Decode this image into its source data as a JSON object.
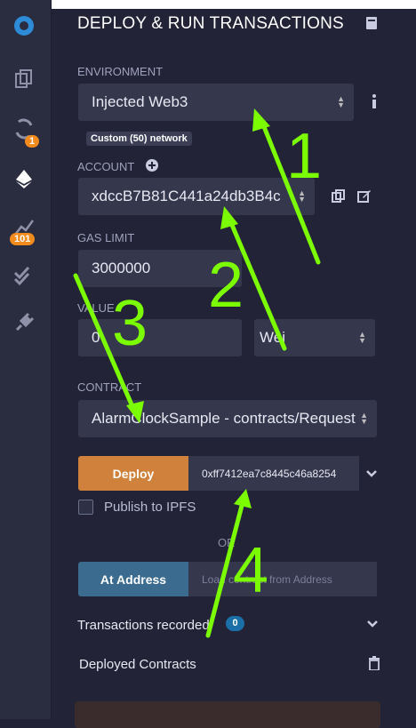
{
  "panel": {
    "title": "DEPLOY & RUN TRANSACTIONS"
  },
  "sidebar": {
    "badge_plugin": "1",
    "badge_analysis": "101"
  },
  "environment": {
    "label": "ENVIRONMENT",
    "value": "Injected Web3",
    "network": "Custom (50) network"
  },
  "account": {
    "label": "ACCOUNT",
    "value": "xdccB7B81C441a24db3B4c"
  },
  "gas_limit": {
    "label": "GAS LIMIT",
    "value": "3000000"
  },
  "value": {
    "label": "VALUE",
    "amount": "0",
    "unit": "Wei"
  },
  "contract": {
    "label": "CONTRACT",
    "value": "AlarmClockSample - contracts/Request"
  },
  "deploy": {
    "button": "Deploy",
    "args": "0xff7412ea7c8445c46a8254"
  },
  "publish": {
    "label": "Publish to IPFS"
  },
  "or_text": "OR",
  "at_address": {
    "button": "At Address",
    "placeholder": "Load contract from Address"
  },
  "transactions": {
    "label": "Transactions recorded",
    "count": "0"
  },
  "deployed": {
    "label": "Deployed Contracts"
  },
  "annotations": {
    "n1": "1",
    "n2": "2",
    "n3": "3",
    "n4": "4",
    "color": "#7cfc00"
  }
}
